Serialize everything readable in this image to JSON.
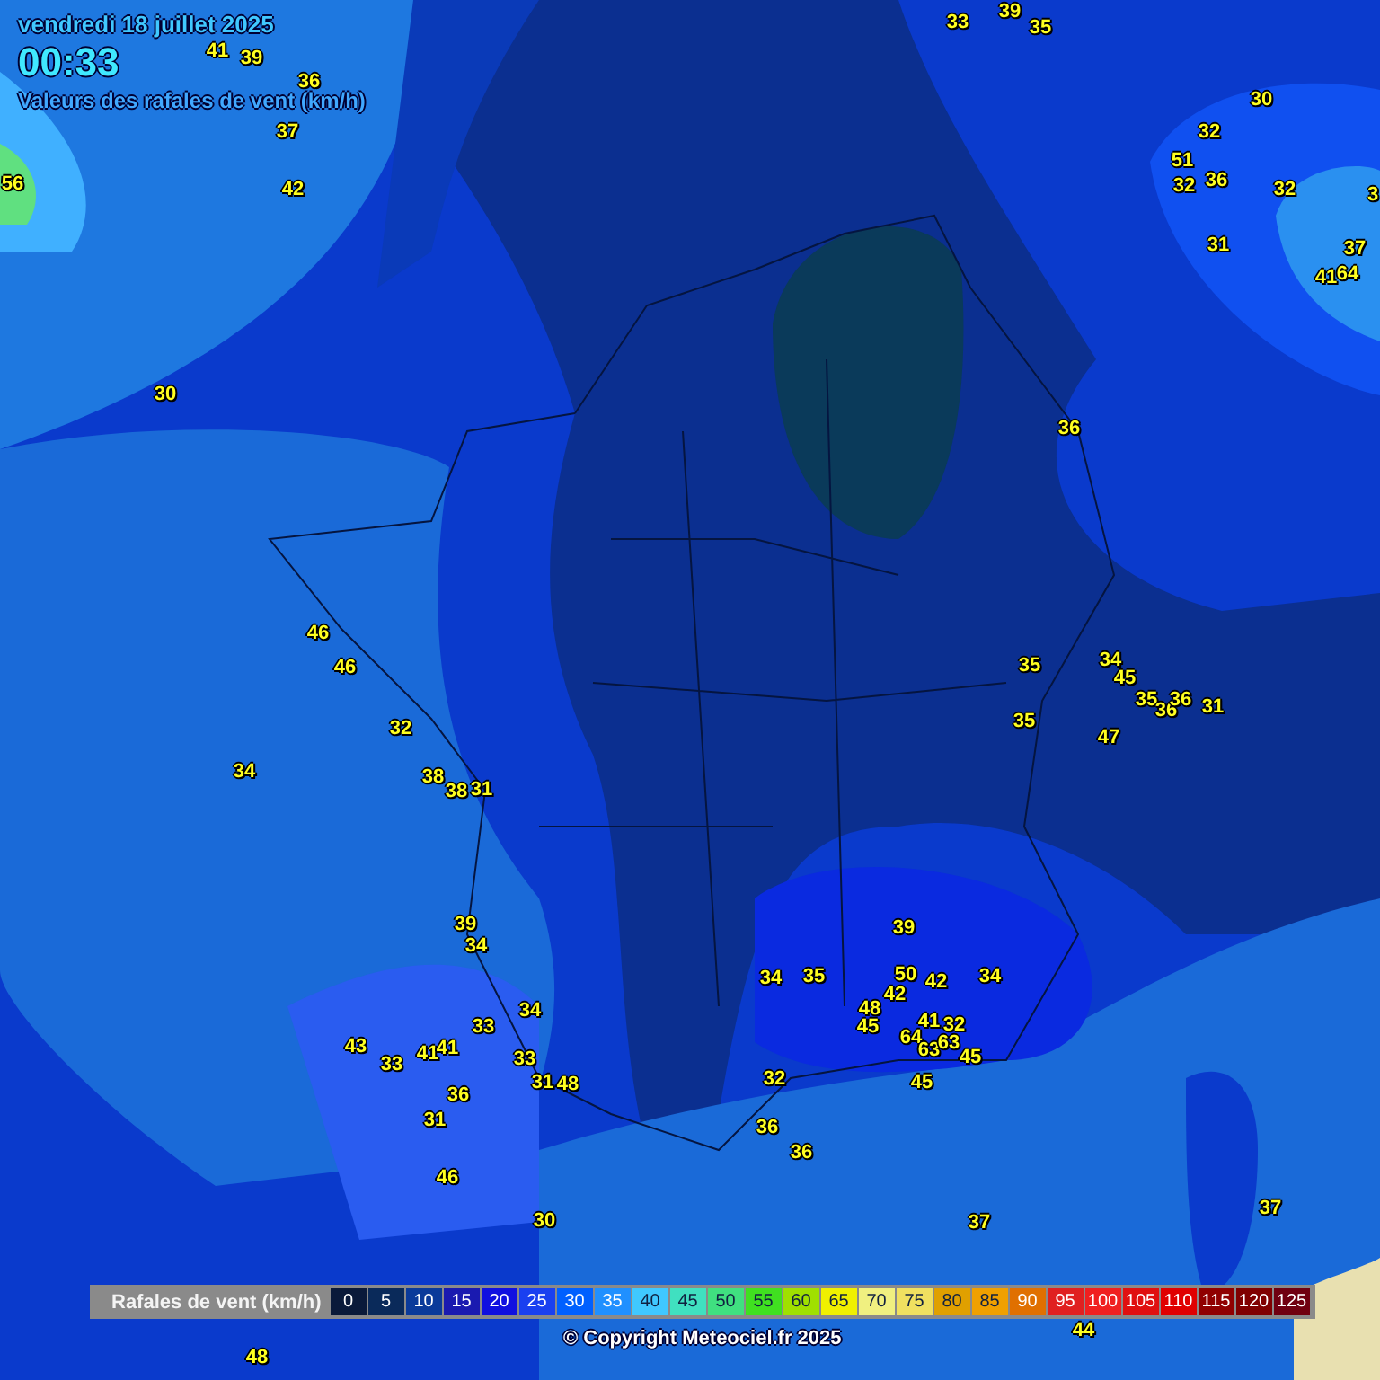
{
  "header": {
    "date": "vendredi 18 juillet 2025",
    "time": "00:33",
    "subtitle": "Valeurs des rafales de vent (km/h)"
  },
  "stations": [
    "39",
    "33",
    "35",
    "41",
    "39",
    "36",
    "30",
    "37",
    "32",
    "51",
    "56",
    "42",
    "32",
    "36",
    "32",
    "3",
    "31",
    "37",
    "41",
    "64",
    "30",
    "36",
    "46",
    "46",
    "35",
    "34",
    "45",
    "35",
    "36",
    "36",
    "31",
    "32",
    "35",
    "47",
    "34",
    "38",
    "38",
    "31",
    "39",
    "39",
    "34",
    "34",
    "35",
    "50",
    "42",
    "34",
    "42",
    "34",
    "48",
    "33",
    "45",
    "41",
    "32",
    "43",
    "33",
    "41",
    "41",
    "33",
    "64",
    "63",
    "63",
    "45",
    "31",
    "48",
    "32",
    "45",
    "36",
    "31",
    "36",
    "36",
    "46",
    "30",
    "37",
    "37",
    "44",
    "48"
  ],
  "legend": {
    "label": "Rafales de vent (km/h)",
    "steps": [
      {
        "value": "0",
        "color": "#0a1a3a"
      },
      {
        "value": "5",
        "color": "#0a2a5a"
      },
      {
        "value": "10",
        "color": "#0a3a9a"
      },
      {
        "value": "15",
        "color": "#1a1ab0"
      },
      {
        "value": "20",
        "color": "#1010e0"
      },
      {
        "value": "25",
        "color": "#1a40f0"
      },
      {
        "value": "30",
        "color": "#0060ff"
      },
      {
        "value": "35",
        "color": "#2090ff"
      },
      {
        "value": "40",
        "color": "#40c8ff"
      },
      {
        "value": "45",
        "color": "#40e0c0"
      },
      {
        "value": "50",
        "color": "#40e080"
      },
      {
        "value": "55",
        "color": "#40e020"
      },
      {
        "value": "60",
        "color": "#a0e000"
      },
      {
        "value": "65",
        "color": "#f0f000"
      },
      {
        "value": "70",
        "color": "#f0f080"
      },
      {
        "value": "75",
        "color": "#f0e060"
      },
      {
        "value": "80",
        "color": "#e0a000"
      },
      {
        "value": "85",
        "color": "#f0a000"
      },
      {
        "value": "90",
        "color": "#e07000"
      },
      {
        "value": "95",
        "color": "#e02020"
      },
      {
        "value": "100",
        "color": "#f02020"
      },
      {
        "value": "105",
        "color": "#e01010"
      },
      {
        "value": "110",
        "color": "#e00000"
      },
      {
        "value": "115",
        "color": "#900000"
      },
      {
        "value": "120",
        "color": "#800000"
      },
      {
        "value": "125",
        "color": "#700010"
      }
    ]
  },
  "copyright": "© Copyright Meteociel.fr 2025"
}
